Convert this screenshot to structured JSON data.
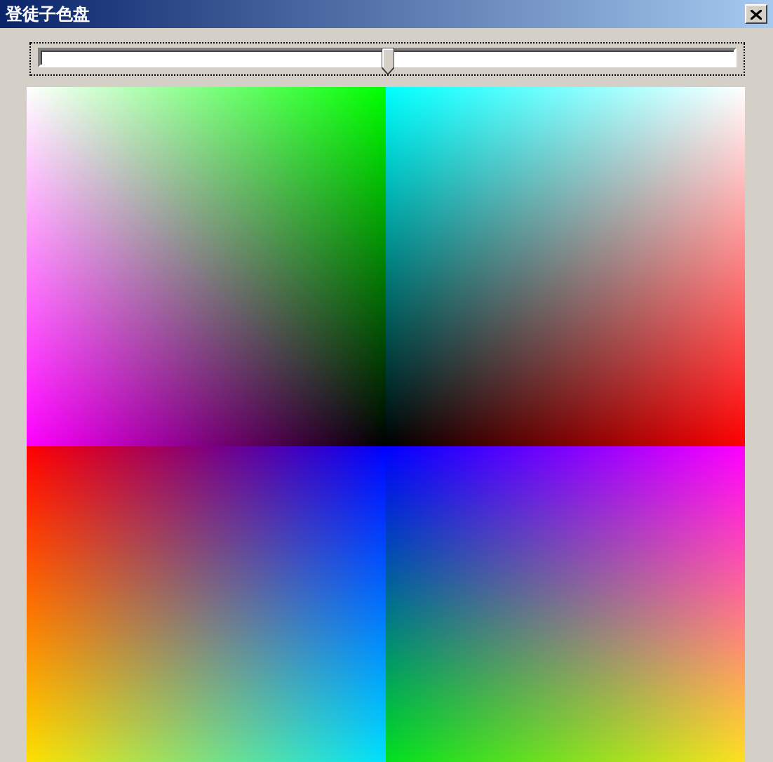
{
  "window": {
    "title": "登徒子色盘"
  },
  "slider": {
    "level": 0.5
  }
}
